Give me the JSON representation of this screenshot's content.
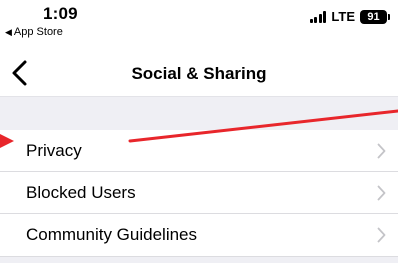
{
  "status_bar": {
    "time": "1:09",
    "back_app": "App Store",
    "network": "LTE",
    "battery": "91"
  },
  "nav": {
    "title": "Social & Sharing"
  },
  "settings": {
    "items": [
      {
        "label": "Privacy"
      },
      {
        "label": "Blocked Users"
      },
      {
        "label": "Community Guidelines"
      }
    ]
  },
  "colors": {
    "annotation_arrow": "#e8262b",
    "group_background": "#efeff4",
    "chevron": "#c4c4c8"
  },
  "icons": {
    "back": "chevron-left-icon",
    "disclosure": "chevron-right-icon",
    "signal": "cellular-signal-icon",
    "battery": "battery-icon"
  }
}
